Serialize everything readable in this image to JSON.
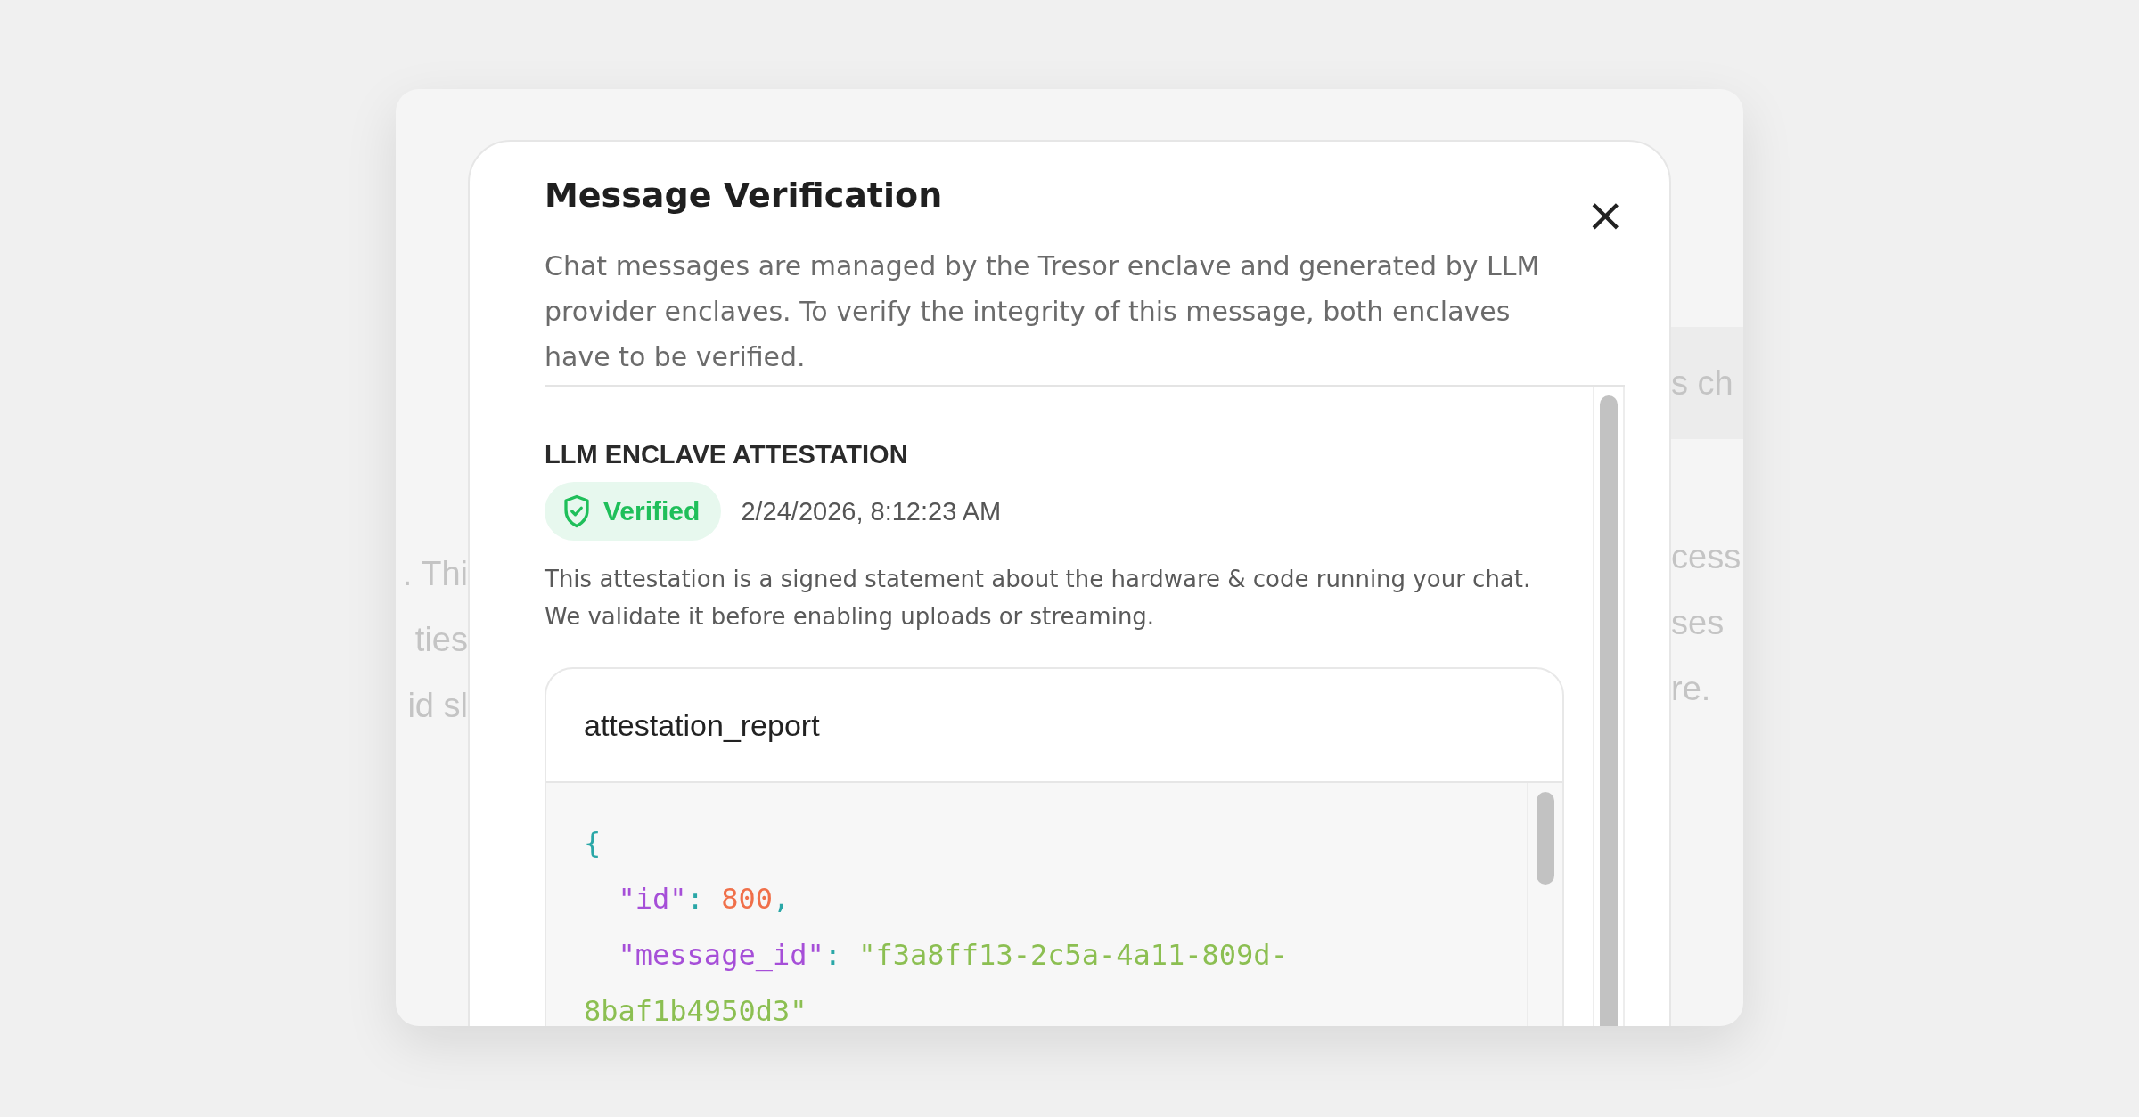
{
  "background": {
    "left_fragments": [
      ". Thi",
      "ties",
      "id sl"
    ],
    "right_fragments": [
      "s ch",
      "cess",
      "ses",
      "re."
    ]
  },
  "dialog": {
    "title": "Message Verification",
    "close": "×",
    "description": "Chat messages are managed by the Tresor enclave and generated by LLM provider enclaves. To verify the integrity of this message, both enclaves have to be verified.",
    "section": {
      "heading": "LLM ENCLAVE ATTESTATION",
      "status": {
        "kind": "verified",
        "label": "Verified"
      },
      "timestamp": "2/24/2026, 8:12:23 AM",
      "note": "This attestation is a signed statement about the hardware & code running your chat. We validate it before enabling uploads or streaming.",
      "report": {
        "title": "attestation_report",
        "lines": [
          [
            {
              "kind": "punct",
              "text": "{"
            }
          ],
          [
            {
              "kind": "key",
              "text": "  \"id\""
            },
            {
              "kind": "plain",
              "text": ": "
            },
            {
              "kind": "number",
              "text": "800"
            },
            {
              "kind": "plain",
              "text": ","
            }
          ],
          [
            {
              "kind": "key",
              "text": "  \"message_id\""
            },
            {
              "kind": "plain",
              "text": ": "
            },
            {
              "kind": "string",
              "text": "\"f3a8ff13-2c5a-4a11-809d-"
            }
          ],
          [
            {
              "kind": "string",
              "text": "8baf1b4950d3\""
            }
          ]
        ]
      }
    }
  }
}
